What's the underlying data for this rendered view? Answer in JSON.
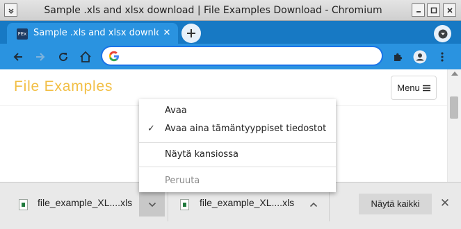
{
  "window": {
    "title": "Sample .xls and xlsx download | File Examples Download - Chromium"
  },
  "tab": {
    "favicon_text": "FEx",
    "title": "Sample .xls and xlsx download",
    "close_glyph": "✕",
    "new_tab_glyph": "+"
  },
  "toolbar": {
    "omnibox_value": ""
  },
  "page": {
    "site_title": "File Examples",
    "menu_label": "Menu"
  },
  "context_menu": {
    "items": [
      {
        "label": "Avaa"
      },
      {
        "label": "Avaa aina tämäntyyppiset tiedostot",
        "checked": true
      },
      {
        "label": "Näytä kansiossa"
      },
      {
        "label": "Peruuta",
        "disabled": true
      }
    ],
    "check_glyph": "✓"
  },
  "downloads": {
    "items": [
      {
        "filename": "file_example_XL....xls"
      },
      {
        "filename": "file_example_XL....xls"
      }
    ],
    "show_all_label": "Näytä kaikki",
    "close_glyph": "✕"
  },
  "colors": {
    "tabstrip": "#1779c4",
    "toolbar": "#2a93e0",
    "site_title": "#f2bf45",
    "omnibox_border": "#1a73e8"
  }
}
